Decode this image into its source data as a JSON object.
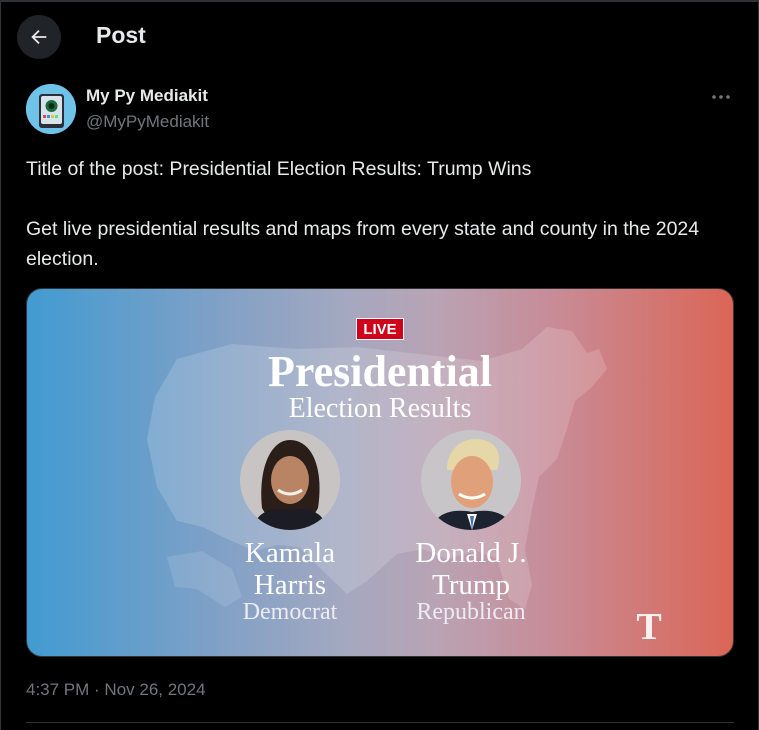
{
  "header": {
    "title": "Post"
  },
  "author": {
    "display_name": "My Py Mediakit",
    "handle": "@MyPyMediakit"
  },
  "post": {
    "line1": "Title of the post: Presidential Election Results: Trump Wins",
    "line2": "Get live presidential results and maps from every state and county in the 2024 election.",
    "timestamp": "4:37 PM · Nov 26, 2024"
  },
  "media": {
    "badge": "LIVE",
    "title": "Presidential",
    "subtitle": "Election Results",
    "candidates": [
      {
        "first": "Kamala",
        "last": "Harris",
        "party": "Democrat"
      },
      {
        "first": "Donald J.",
        "last": "Trump",
        "party": "Republican"
      }
    ],
    "logo": "T"
  },
  "colors": {
    "democrat": "#419bd1",
    "republican": "#db6656",
    "background": "#000000",
    "muted": "#71767b"
  },
  "icons": {
    "back": "arrow-left-icon",
    "more": "more-horizontal-icon"
  }
}
